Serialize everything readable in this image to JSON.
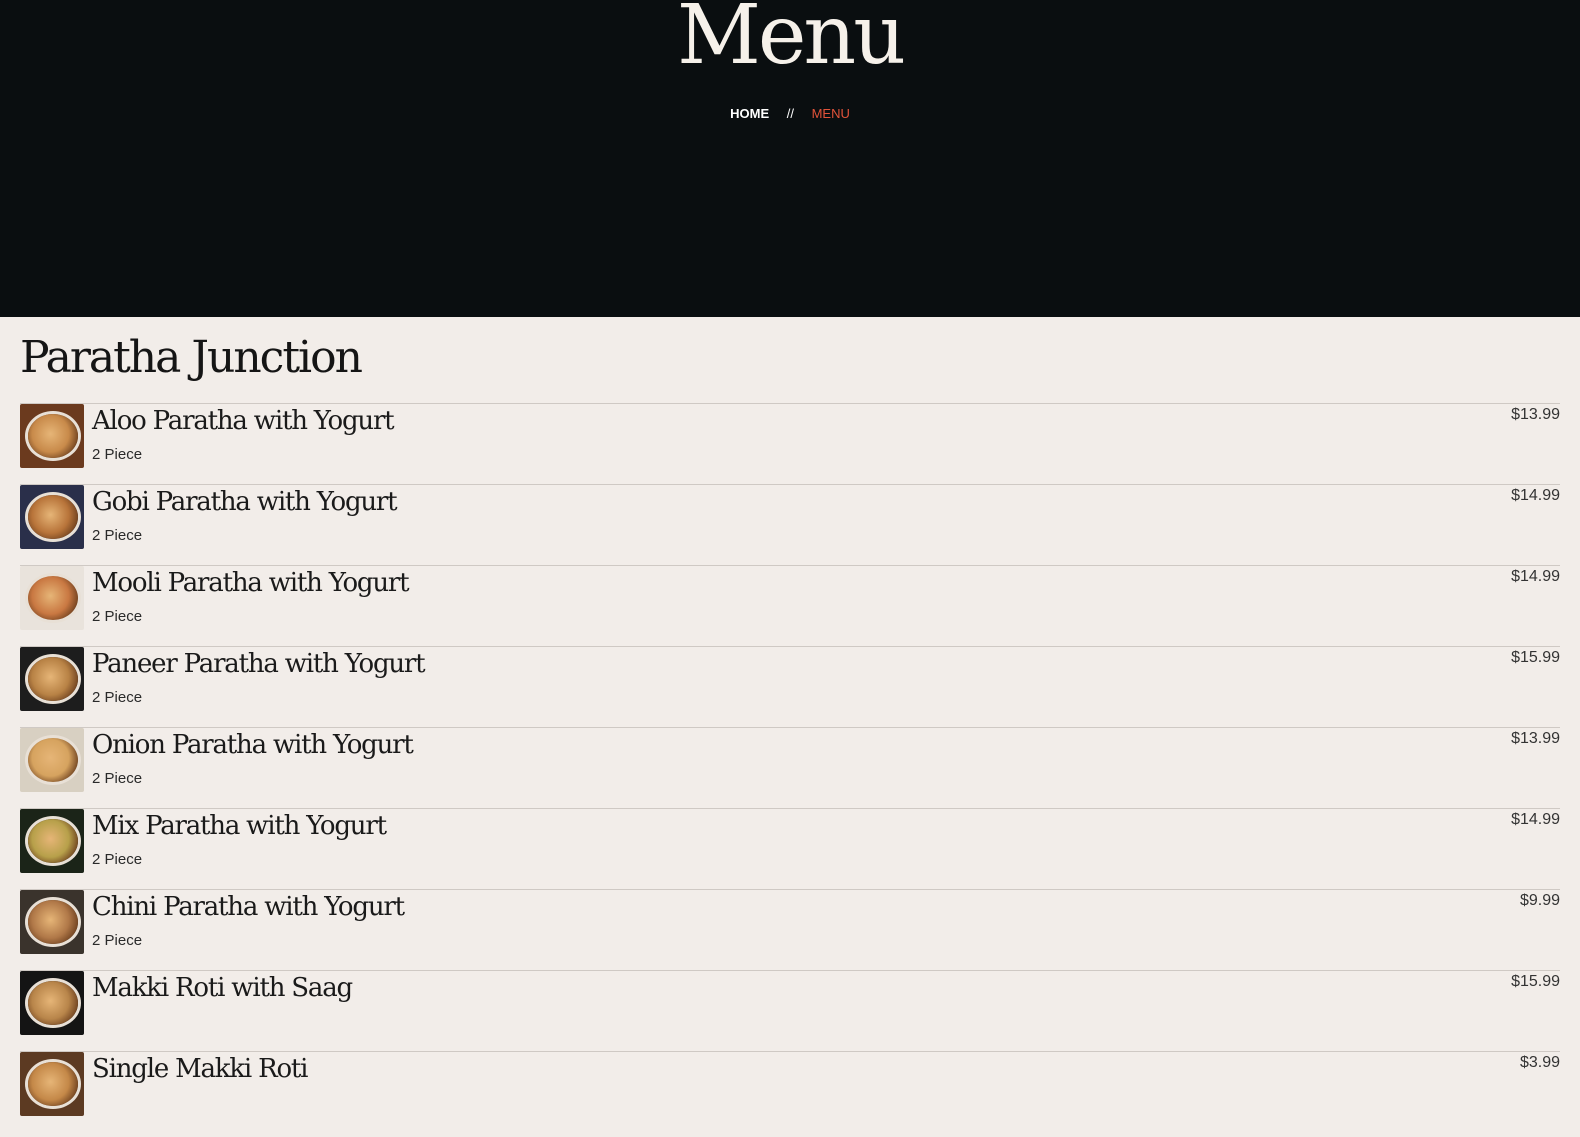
{
  "hero": {
    "title": "Menu",
    "breadcrumb": {
      "home": "HOME",
      "separator": "//",
      "current": "MENU"
    }
  },
  "category": {
    "title": "Paratha Junction",
    "items": [
      {
        "name": "Aloo Paratha with Yogurt",
        "desc": "2 Piece",
        "price": "$13.99",
        "thumb_colors": [
          "#6b3a1e",
          "#c88a4a"
        ]
      },
      {
        "name": "Gobi Paratha with Yogurt",
        "desc": "2 Piece",
        "price": "$14.99",
        "thumb_colors": [
          "#2a2f4a",
          "#b8743a"
        ]
      },
      {
        "name": "Mooli Paratha with Yogurt",
        "desc": "2 Piece",
        "price": "$14.99",
        "thumb_colors": [
          "#e9e3dc",
          "#c97842"
        ]
      },
      {
        "name": "Paneer Paratha with Yogurt",
        "desc": "2 Piece",
        "price": "$15.99",
        "thumb_colors": [
          "#1d1d1d",
          "#b88245"
        ]
      },
      {
        "name": "Onion Paratha with Yogurt",
        "desc": "2 Piece",
        "price": "$13.99",
        "thumb_colors": [
          "#d8d0c2",
          "#d6a35f"
        ]
      },
      {
        "name": "Mix Paratha with Yogurt",
        "desc": "2 Piece",
        "price": "$14.99",
        "thumb_colors": [
          "#1b2418",
          "#b7a04a"
        ]
      },
      {
        "name": "Chini Paratha with Yogurt",
        "desc": "2 Piece",
        "price": "$9.99",
        "thumb_colors": [
          "#3a332c",
          "#b07848"
        ]
      },
      {
        "name": "Makki Roti with Saag",
        "desc": "",
        "price": "$15.99",
        "thumb_colors": [
          "#141414",
          "#b8854a"
        ]
      },
      {
        "name": "Single Makki Roti",
        "desc": "",
        "price": "$3.99",
        "thumb_colors": [
          "#5c3a22",
          "#c48848"
        ]
      }
    ]
  }
}
